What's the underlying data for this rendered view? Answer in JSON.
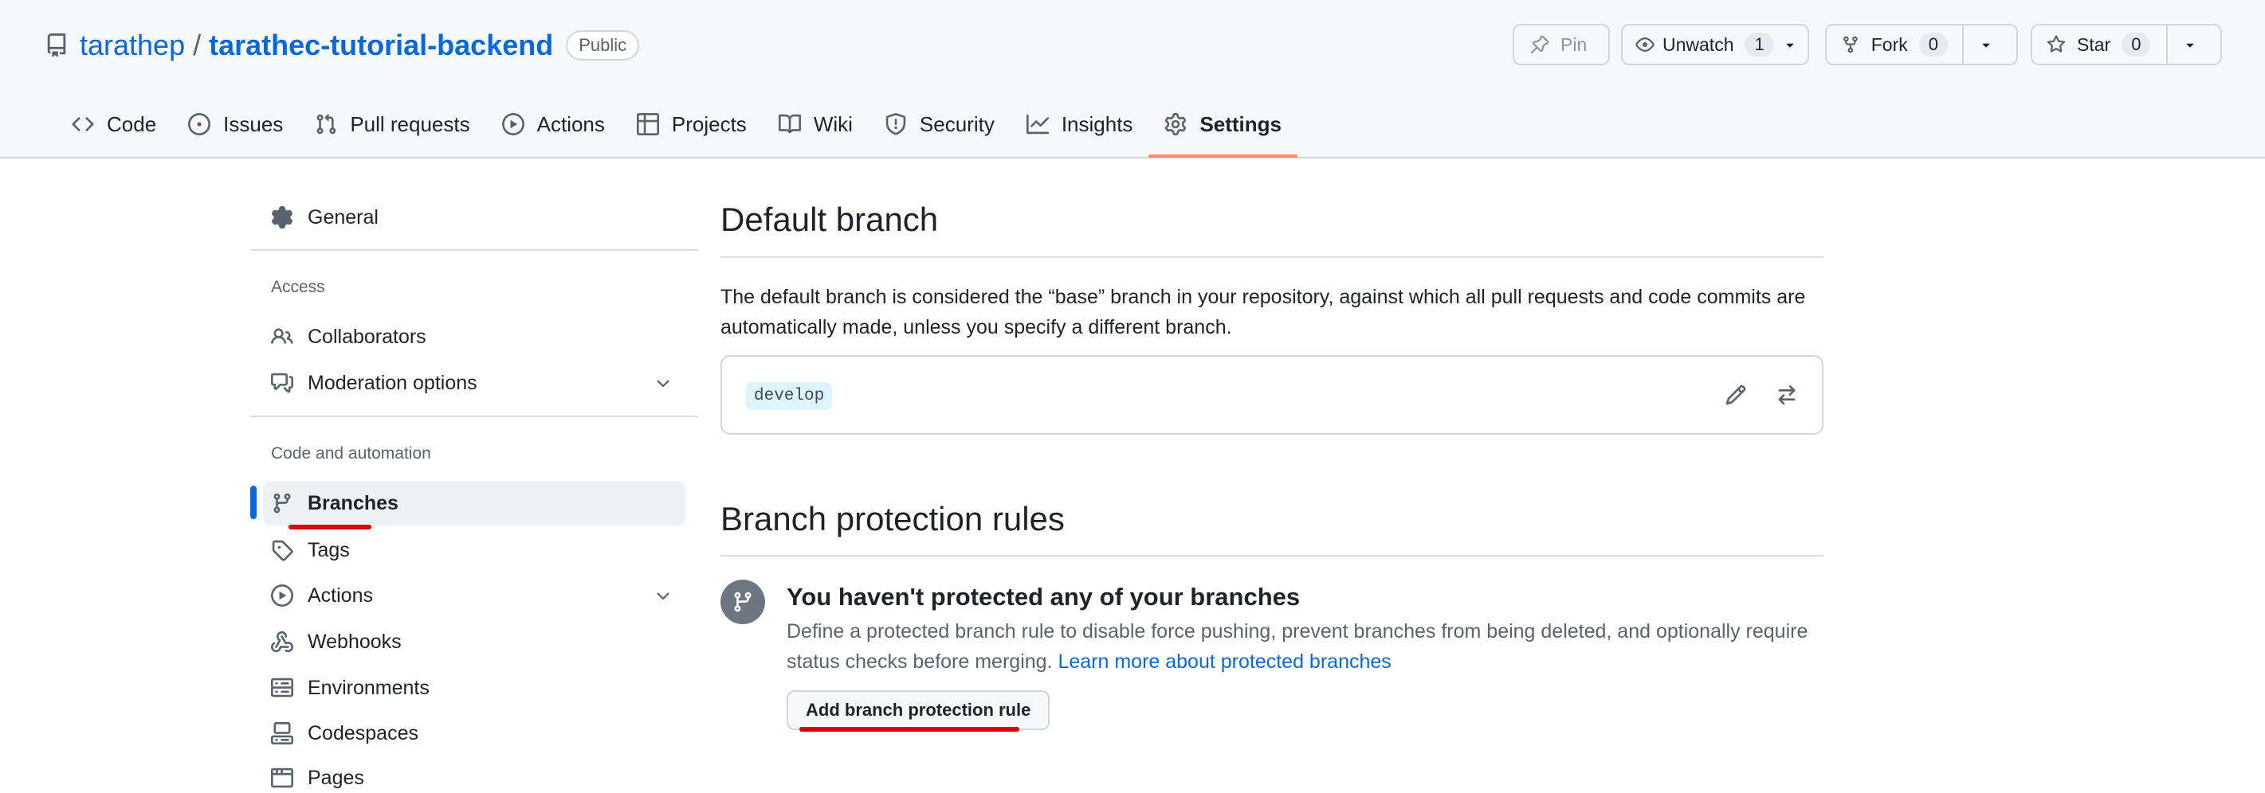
{
  "repo": {
    "owner": "tarathep",
    "separator": "/",
    "name": "tarathec-tutorial-backend",
    "visibility": "Public"
  },
  "header_buttons": {
    "pin": "Pin",
    "unwatch": "Unwatch",
    "watch_count": "1",
    "fork": "Fork",
    "fork_count": "0",
    "star": "Star",
    "star_count": "0"
  },
  "tabs": [
    {
      "label": "Code",
      "icon": "code-icon"
    },
    {
      "label": "Issues",
      "icon": "issue-icon"
    },
    {
      "label": "Pull requests",
      "icon": "pull-request-icon"
    },
    {
      "label": "Actions",
      "icon": "play-icon"
    },
    {
      "label": "Projects",
      "icon": "table-icon"
    },
    {
      "label": "Wiki",
      "icon": "book-icon"
    },
    {
      "label": "Security",
      "icon": "shield-icon"
    },
    {
      "label": "Insights",
      "icon": "graph-icon"
    },
    {
      "label": "Settings",
      "icon": "gear-icon",
      "active": true
    }
  ],
  "sidebar": {
    "general": "General",
    "access_heading": "Access",
    "collaborators": "Collaborators",
    "moderation": "Moderation options",
    "automation_heading": "Code and automation",
    "branches": "Branches",
    "tags": "Tags",
    "actions": "Actions",
    "webhooks": "Webhooks",
    "environments": "Environments",
    "codespaces": "Codespaces",
    "pages": "Pages"
  },
  "default_branch": {
    "title": "Default branch",
    "description": "The default branch is considered the “base” branch in your repository, against which all pull requests and code commits are automatically made, unless you specify a different branch.",
    "branch": "develop"
  },
  "protection": {
    "title": "Branch protection rules",
    "blank_title": "You haven't protected any of your branches",
    "blank_desc": "Define a protected branch rule to disable force pushing, prevent branches from being deleted, and optionally require status checks before merging.",
    "learn_more": "Learn more about protected branches",
    "add_button": "Add branch protection rule"
  },
  "colors": {
    "link": "#0969da",
    "active_tab_underline": "#fd8c73",
    "active_sidebar_marker": "#0969da",
    "annotation": "#e00000"
  }
}
